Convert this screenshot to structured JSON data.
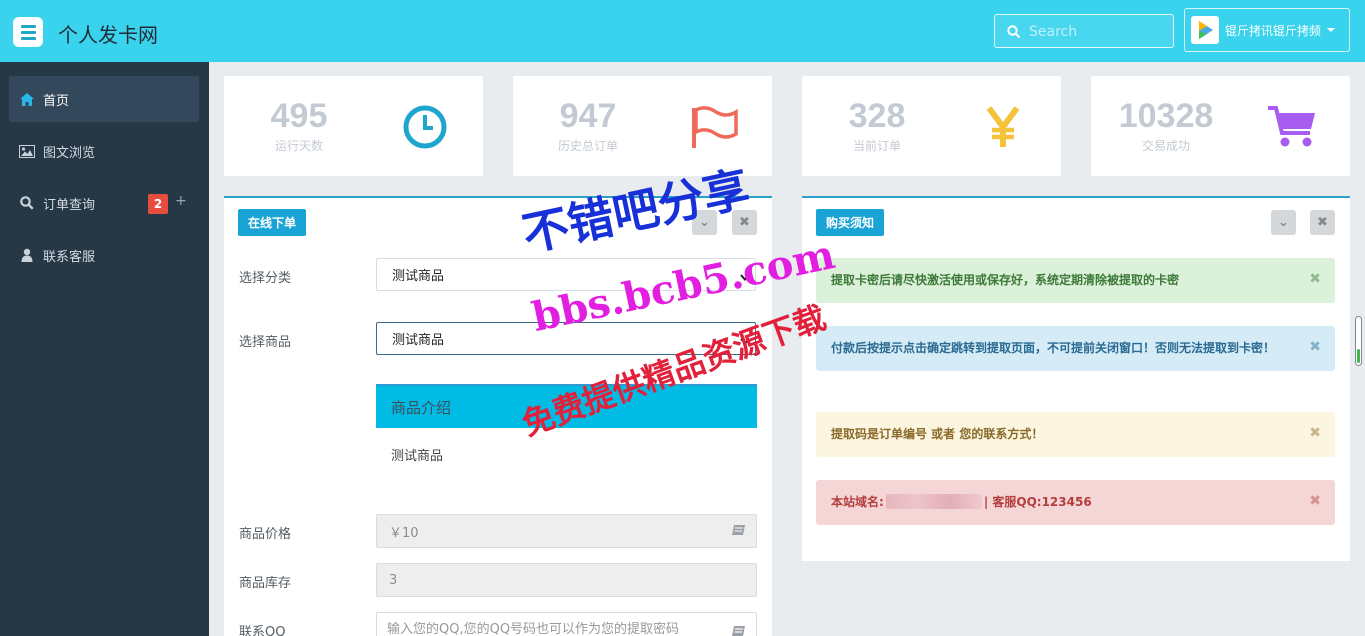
{
  "header": {
    "title": "个人发卡网",
    "search_placeholder": "Search",
    "username": "锟斤拷讯锟斤拷频"
  },
  "sidebar": {
    "items": [
      {
        "label": "首页",
        "icon": "home-icon",
        "active": true
      },
      {
        "label": "图文浏览",
        "icon": "image-icon"
      },
      {
        "label": "订单查询",
        "icon": "search-icon",
        "badge": "2",
        "extra": "+"
      },
      {
        "label": "联系客服",
        "icon": "user-icon"
      }
    ]
  },
  "stats": [
    {
      "value": "495",
      "label": "运行天数",
      "icon": "clock-icon",
      "color": "#1fa6cf"
    },
    {
      "value": "947",
      "label": "历史总订单",
      "icon": "flag-icon",
      "color": "#f06a5b"
    },
    {
      "value": "328",
      "label": "当前订单",
      "icon": "yen-icon",
      "color": "#f5c33b"
    },
    {
      "value": "10328",
      "label": "交易成功",
      "icon": "cart-icon",
      "color": "#a85cf0"
    }
  ],
  "order_panel": {
    "tag": "在线下单",
    "category_label": "选择分类",
    "category_value": "测试商品",
    "product_label": "选择商品",
    "product_value": "测试商品",
    "intro_title": "商品介绍",
    "intro_body": "测试商品",
    "price_label": "商品价格",
    "price_value": "￥10",
    "stock_label": "商品库存",
    "stock_value": "3",
    "qq_label": "联系QQ",
    "qq_placeholder": "输入您的QQ,您的QQ号码也可以作为您的提取密码"
  },
  "notice_panel": {
    "tag": "购买须知",
    "alerts": [
      {
        "text": "提取卡密后请尽快激活使用或保存好，系统定期清除被提取的卡密",
        "type": "success"
      },
      {
        "text": "付款后按提示点击确定跳转到提取页面，不可提前关闭窗口！否则无法提取到卡密！",
        "type": "info"
      },
      {
        "text": "提取码是订单编号 或者 您的联系方式！",
        "type": "warning"
      },
      {
        "text_prefix": "本站域名:",
        "text_suffix": "| 客服QQ:123456",
        "type": "danger"
      }
    ]
  },
  "watermark": {
    "line1": "不错吧分享",
    "line2": "bbs.bcb5.com",
    "line3": "免费提供精品资源下载"
  },
  "colors": {
    "topbar": "#3ad3ee",
    "sidebar": "#263746",
    "accent": "#1aa4d6"
  }
}
